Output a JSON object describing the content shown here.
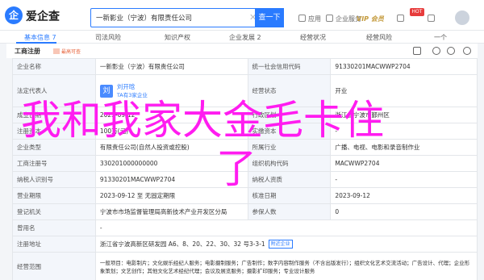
{
  "header": {
    "logo_char": "企",
    "brand": "爱企查",
    "search_value": "一新影业（宁波）有限责任公司",
    "search_button": "查一下",
    "nav": [
      "应用",
      "企业服务"
    ],
    "vip": "VIP 会员",
    "hot_badge": "HOT"
  },
  "tabs": [
    {
      "label": "基本信息 7"
    },
    {
      "label": "司法风险"
    },
    {
      "label": "知识产权"
    },
    {
      "label": "企业发展 2"
    },
    {
      "label": "经营状况"
    },
    {
      "label": "经营风险"
    },
    {
      "label": "一个"
    }
  ],
  "section": {
    "title": "工商注册",
    "badge": "最高可查"
  },
  "table": {
    "row1": {
      "l1": "企业名称",
      "v1": "一新影业（宁波）有限责任公司",
      "l2": "统一社会信用代码",
      "v2": "91330201MACWWP2704"
    },
    "row2": {
      "l1": "法定代表人",
      "avatar_char": "刘",
      "rep_name": "刘开晗",
      "rep_sub": "TA有3家企业",
      "l2": "经营状态",
      "v2": "开业"
    },
    "row3": {
      "l1": "成立日期",
      "v1": "2023-09-12",
      "l2": "行政区划",
      "v2": "浙江省宁波市鄞州区"
    },
    "row4": {
      "l1": "注册资本",
      "v1": "100万(元)",
      "l2": "实缴资本",
      "v2": "-"
    },
    "row5": {
      "l1": "企业类型",
      "v1": "有限责任公司(自然人投资或控股)",
      "l2": "所属行业",
      "v2": "广播、电视、电影和录音制作业"
    },
    "row6": {
      "l1": "工商注册号",
      "v1": "330201000000000",
      "l2": "组织机构代码",
      "v2": "MACWWP2704"
    },
    "row7": {
      "l1": "纳税人识别号",
      "v1": "91330201MACWWP2704",
      "l2": "纳税人资质",
      "v2": "-"
    },
    "row8": {
      "l1": "营业期限",
      "v1": "2023-09-12 至 无固定期限",
      "l2": "核准日期",
      "v2": "2023-09-12"
    },
    "row9": {
      "l1": "登记机关",
      "v1": "宁波市市场监督管理局高新技术产业开发区分局",
      "l2": "参保人数",
      "v2": "0"
    },
    "row10": {
      "l1": "曾用名",
      "v1": "-"
    },
    "row11": {
      "l1": "注册地址",
      "v1": "浙江省宁波高新区研发园 A6、8、20、22、30、32 号3-3-1",
      "btn": "附近企业"
    },
    "row12": {
      "l1": "经营范围",
      "v1": "一般项目：电影制片；文化娱乐经纪人服务；电影摄制服务；广告制作；数字内容制作服务（不含出版发行）；组织文化艺术交流活动；广告设计、代理；企业形象策划；文艺创作；其他文化艺术经纪代理；会议及展览服务；摄影扩印服务；专业设计服务"
    }
  },
  "overlay": {
    "line1": "我和我家大金毛卡住",
    "line2": "了"
  }
}
